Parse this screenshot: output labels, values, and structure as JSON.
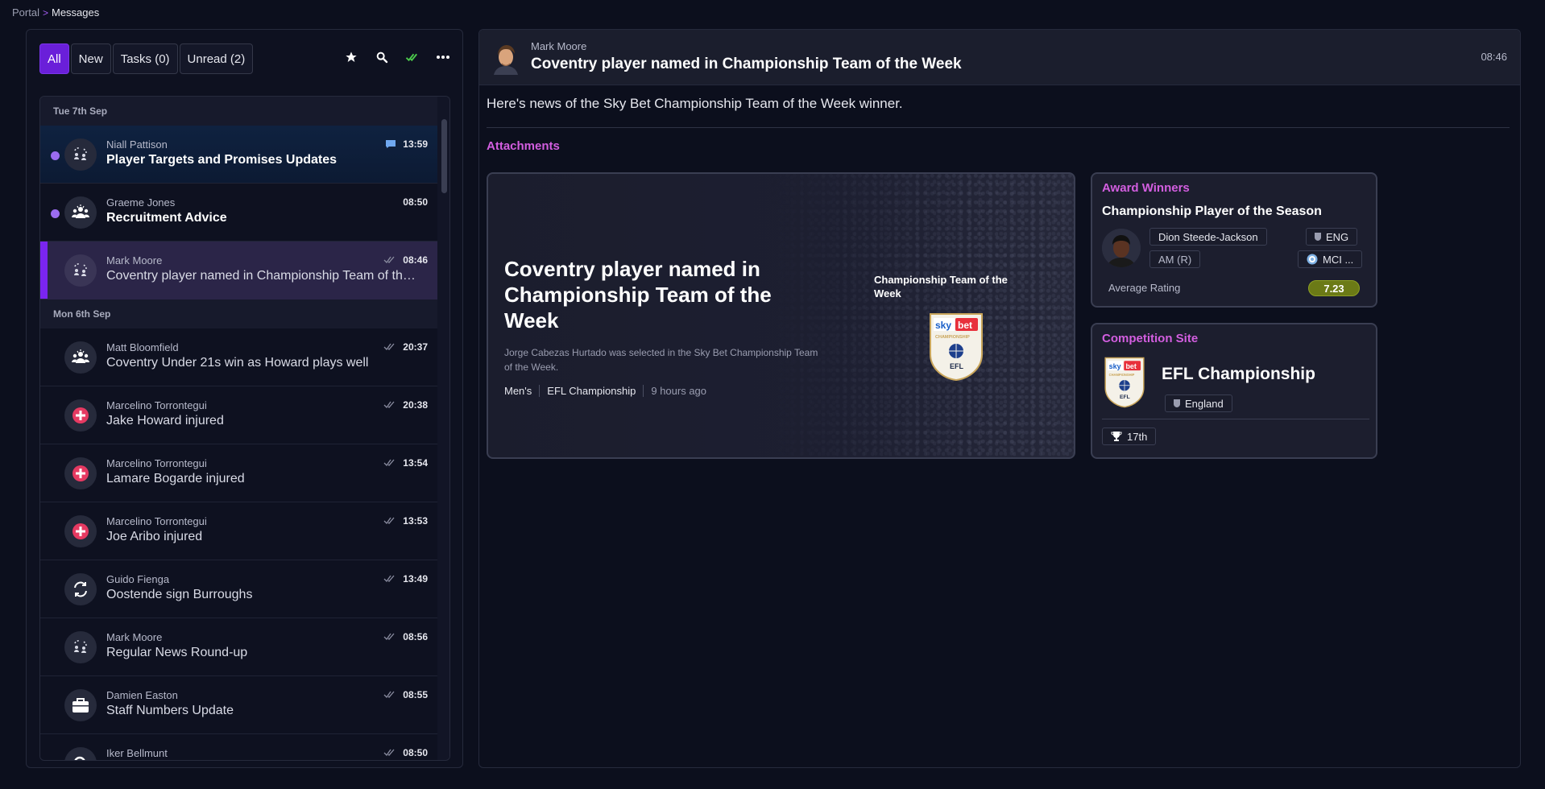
{
  "breadcrumb": {
    "parent": "Portal",
    "separator": ">",
    "current": "Messages"
  },
  "filters": [
    {
      "label": "All",
      "active": true
    },
    {
      "label": "New",
      "active": false
    },
    {
      "label": "Tasks (0)",
      "active": false
    },
    {
      "label": "Unread (2)",
      "active": false
    }
  ],
  "toolbar_icons": [
    "star-icon",
    "search-icon",
    "mark-read-icon",
    "more-icon"
  ],
  "messages": {
    "date_1": "Tue 7th Sep",
    "date_2": "Mon 6th Sep",
    "items": [
      {
        "sender": "Niall Pattison",
        "subject": "Player Targets and Promises Updates",
        "time": "13:59",
        "icon": "transfer-people-icon",
        "status_icon": "chat-icon",
        "unread": true
      },
      {
        "sender": "Graeme Jones",
        "subject": "Recruitment Advice",
        "time": "08:50",
        "icon": "group-icon",
        "unread": true
      },
      {
        "sender": "Mark Moore",
        "subject": "Coventry player named in Championship Team of the Week",
        "time": "08:46",
        "icon": "transfer-people-icon",
        "status_icon": "read-check-icon",
        "selected": true
      },
      {
        "sender": "Matt Bloomfield",
        "subject": "Coventry Under 21s win as Howard plays well",
        "time": "20:37",
        "icon": "group-icon",
        "status_icon": "read-check-icon"
      },
      {
        "sender": "Marcelino Torrontegui",
        "subject": "Jake Howard injured",
        "time": "20:38",
        "icon": "injury-icon",
        "status_icon": "read-check-icon"
      },
      {
        "sender": "Marcelino Torrontegui",
        "subject": "Lamare Bogarde injured",
        "time": "13:54",
        "icon": "injury-icon",
        "status_icon": "read-check-icon"
      },
      {
        "sender": "Marcelino Torrontegui",
        "subject": "Joe Aribo injured",
        "time": "13:53",
        "icon": "injury-icon",
        "status_icon": "read-check-icon"
      },
      {
        "sender": "Guido Fienga",
        "subject": "Oostende sign Burroughs",
        "time": "13:49",
        "icon": "swap-icon",
        "status_icon": "read-check-icon"
      },
      {
        "sender": "Mark Moore",
        "subject": "Regular News Round-up",
        "time": "08:56",
        "icon": "transfer-people-icon",
        "status_icon": "read-check-icon"
      },
      {
        "sender": "Damien Easton",
        "subject": "Staff Numbers Update",
        "time": "08:55",
        "icon": "briefcase-icon",
        "status_icon": "read-check-icon"
      },
      {
        "sender": "Iker Bellmunt",
        "subject": "",
        "time": "08:50",
        "icon": "scout-icon",
        "status_icon": "read-check-icon"
      }
    ]
  },
  "detail": {
    "sender": "Mark Moore",
    "title": "Coventry player named in Championship Team of the Week",
    "time": "08:46",
    "body": "Here's news of the Sky Bet Championship Team of the Week winner.",
    "attachments_label": "Attachments"
  },
  "news_card": {
    "title": "Coventry player named in Championship Team of the Week",
    "description": "Jorge Cabezas Hurtado was selected in the Sky Bet Championship Team of the Week.",
    "tags": [
      "Men's",
      "EFL Championship",
      "9 hours ago"
    ],
    "side_label": "Championship Team of the Week"
  },
  "award_card": {
    "label": "Award Winners",
    "title": "Championship Player of the Season",
    "player": "Dion Steede-Jackson",
    "nation": "ENG",
    "position": "AM (R)",
    "club": "MCI ...",
    "rating_label": "Average Rating",
    "rating": "7.23"
  },
  "competition_card": {
    "label": "Competition Site",
    "name": "EFL Championship",
    "country": "England",
    "position": "17th"
  },
  "logo": {
    "sky": "sky",
    "bet": "bet",
    "champ": "CHAMPIONSHIP",
    "efl": "EFL"
  },
  "colors": {
    "accent": "#6a1fd9",
    "label": "#d35ee0",
    "rating": "#6b7a16",
    "injury": "#e63a62",
    "unread": "#9b6cf0"
  }
}
